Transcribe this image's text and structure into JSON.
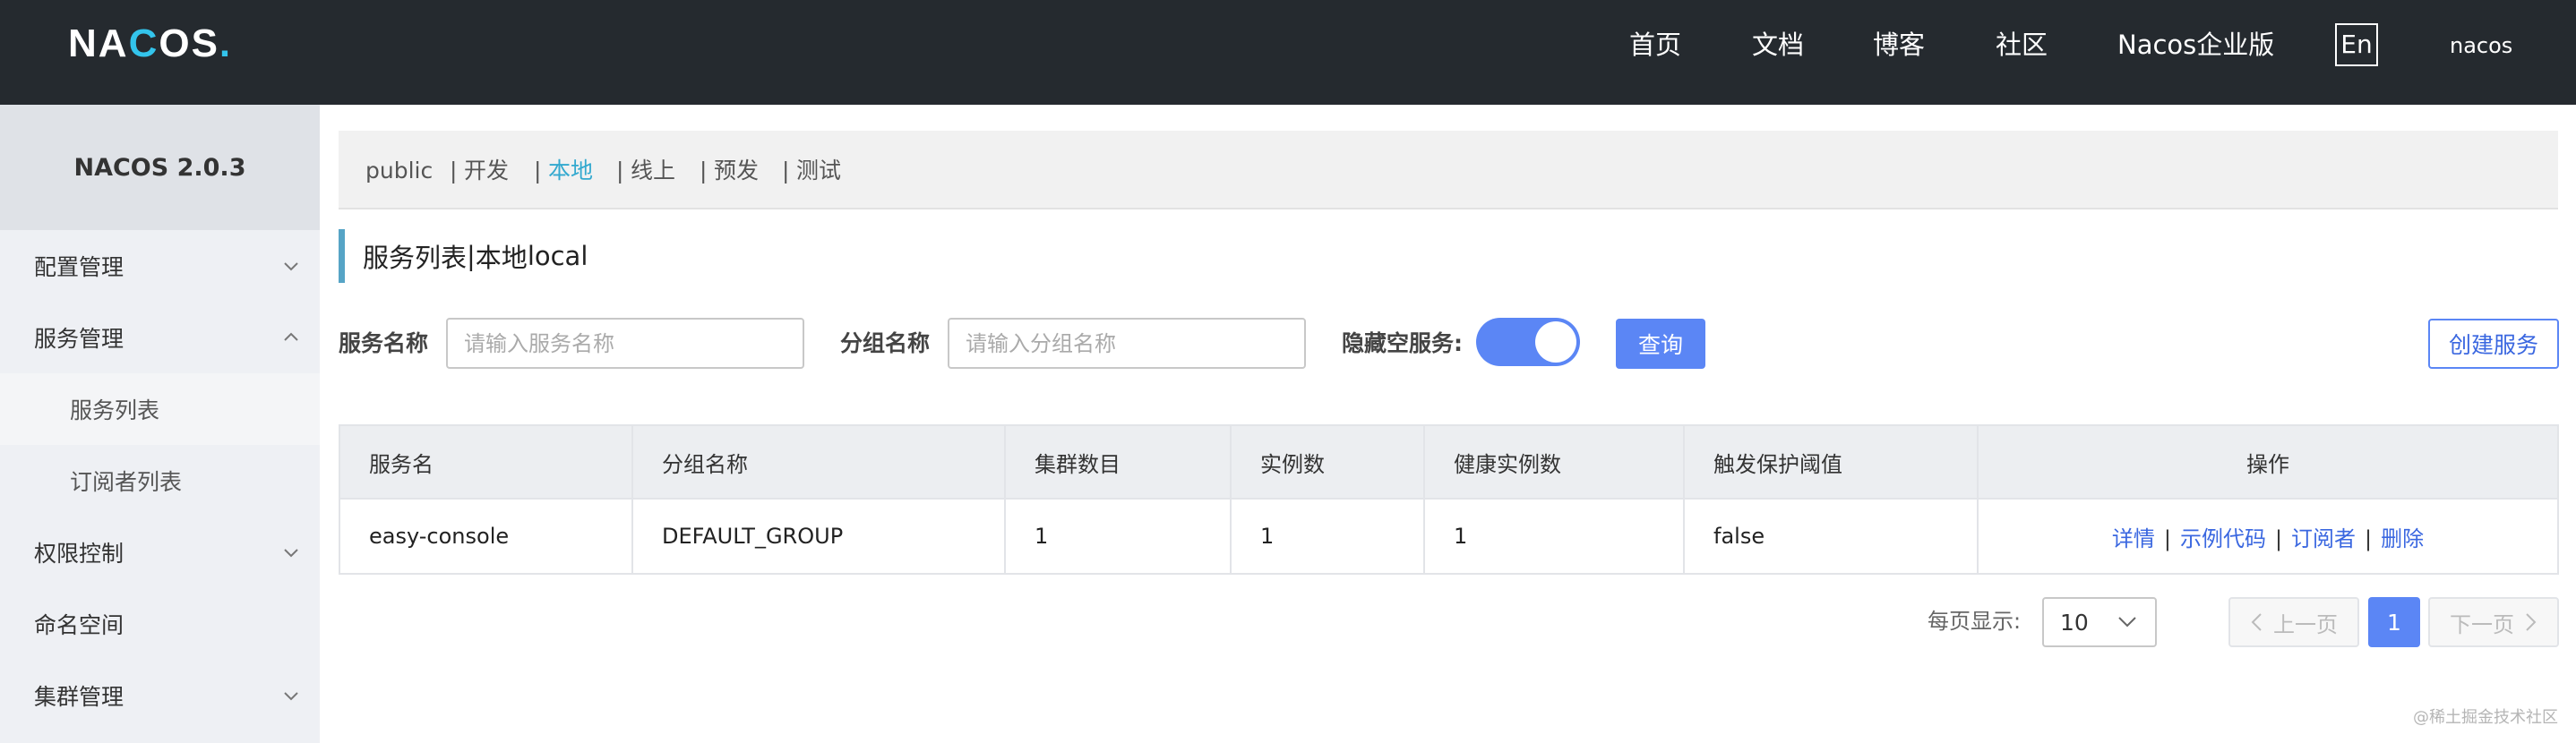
{
  "header": {
    "logo": {
      "part1": "NA",
      "part2": "C",
      "part3": "OS",
      "dot": "."
    },
    "nav": [
      "首页",
      "文档",
      "博客",
      "社区",
      "Nacos企业版"
    ],
    "lang": "En",
    "user": "nacos"
  },
  "sidebar": {
    "title": "NACOS 2.0.3",
    "items": [
      {
        "label": "配置管理"
      },
      {
        "label": "服务管理"
      },
      {
        "label": "服务列表"
      },
      {
        "label": "订阅者列表"
      },
      {
        "label": "权限控制"
      },
      {
        "label": "命名空间"
      },
      {
        "label": "集群管理"
      }
    ]
  },
  "namespaces": [
    "public",
    "开发",
    "本地",
    "线上",
    "预发",
    "测试"
  ],
  "namespace_separator": "|",
  "page_title": {
    "main": "服务列表",
    "sep": "|",
    "ns_name": "本地",
    "ns_id": "local"
  },
  "filters": {
    "service_name_label": "服务名称",
    "service_name_placeholder": "请输入服务名称",
    "group_name_label": "分组名称",
    "group_name_placeholder": "请输入分组名称",
    "hide_empty_label": "隐藏空服务:",
    "hide_empty": true,
    "query_button": "查询",
    "create_button": "创建服务"
  },
  "table": {
    "columns": [
      "服务名",
      "分组名称",
      "集群数目",
      "实例数",
      "健康实例数",
      "触发保护阈值",
      "操作"
    ],
    "rows": [
      {
        "service": "easy-console",
        "group": "DEFAULT_GROUP",
        "clusters": "1",
        "instances": "1",
        "healthy": "1",
        "threshold": "false"
      }
    ],
    "actions": [
      "详情",
      "示例代码",
      "订阅者",
      "删除"
    ],
    "action_sep": "|"
  },
  "pagination": {
    "page_size_label": "每页显示:",
    "page_size": "10",
    "prev": "上一页",
    "current": "1",
    "next": "下一页"
  },
  "watermark": "@稀土掘金技术社区",
  "colors": {
    "header_bg": "#252a2f",
    "accent": "#5b86f5",
    "ns_active": "#33a9cf",
    "logo_accent": "#33c4ec"
  }
}
